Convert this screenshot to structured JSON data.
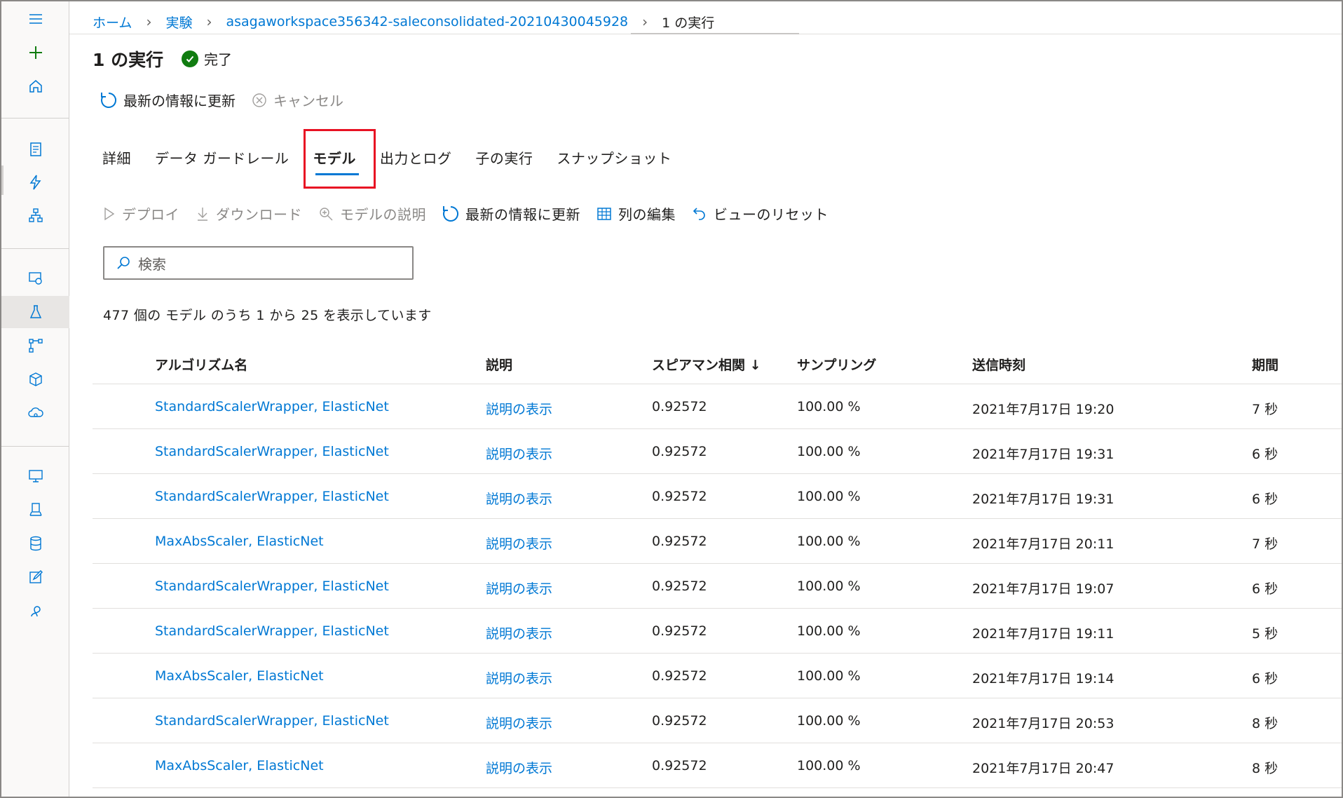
{
  "breadcrumb": {
    "home": "ホーム",
    "experiments": "実験",
    "experiment_name": "asagaworkspace356342-saleconsolidated-20210430045928",
    "current": "1 の実行"
  },
  "page": {
    "title": "1 の実行",
    "status": "完了"
  },
  "commands": {
    "refresh": "最新の情報に更新",
    "cancel": "キャンセル"
  },
  "tabs": [
    "詳細",
    "データ ガードレール",
    "モデル",
    "出力とログ",
    "子の実行",
    "スナップショット"
  ],
  "selected_tab": "モデル",
  "toolbar": {
    "deploy": "デプロイ",
    "download": "ダウンロード",
    "explain": "モデルの説明",
    "refresh": "最新の情報に更新",
    "edit_columns": "列の編集",
    "reset_view": "ビューのリセット"
  },
  "search": {
    "placeholder": "検索"
  },
  "summary": "477 個の モデル のうち 1 から 25 を表示しています",
  "table": {
    "columns": {
      "algorithm": "アルゴリズム名",
      "explanation": "説明",
      "spearman": "スピアマン相関 ↓",
      "sampling": "サンプリング",
      "submitted": "送信時刻",
      "duration": "期間"
    },
    "rows": [
      {
        "algorithm": "StandardScalerWrapper, ElasticNet",
        "explanation": "説明の表示",
        "spearman": "0.92572",
        "sampling": "100.00 %",
        "submitted": "2021年7月17日 19:20",
        "duration": "7 秒"
      },
      {
        "algorithm": "StandardScalerWrapper, ElasticNet",
        "explanation": "説明の表示",
        "spearman": "0.92572",
        "sampling": "100.00 %",
        "submitted": "2021年7月17日 19:31",
        "duration": "6 秒"
      },
      {
        "algorithm": "StandardScalerWrapper, ElasticNet",
        "explanation": "説明の表示",
        "spearman": "0.92572",
        "sampling": "100.00 %",
        "submitted": "2021年7月17日 19:31",
        "duration": "6 秒"
      },
      {
        "algorithm": "MaxAbsScaler, ElasticNet",
        "explanation": "説明の表示",
        "spearman": "0.92572",
        "sampling": "100.00 %",
        "submitted": "2021年7月17日 20:11",
        "duration": "7 秒"
      },
      {
        "algorithm": "StandardScalerWrapper, ElasticNet",
        "explanation": "説明の表示",
        "spearman": "0.92572",
        "sampling": "100.00 %",
        "submitted": "2021年7月17日 19:07",
        "duration": "6 秒"
      },
      {
        "algorithm": "StandardScalerWrapper, ElasticNet",
        "explanation": "説明の表示",
        "spearman": "0.92572",
        "sampling": "100.00 %",
        "submitted": "2021年7月17日 19:11",
        "duration": "5 秒"
      },
      {
        "algorithm": "MaxAbsScaler, ElasticNet",
        "explanation": "説明の表示",
        "spearman": "0.92572",
        "sampling": "100.00 %",
        "submitted": "2021年7月17日 19:14",
        "duration": "6 秒"
      },
      {
        "algorithm": "StandardScalerWrapper, ElasticNet",
        "explanation": "説明の表示",
        "spearman": "0.92572",
        "sampling": "100.00 %",
        "submitted": "2021年7月17日 20:53",
        "duration": "8 秒"
      },
      {
        "algorithm": "MaxAbsScaler, ElasticNet",
        "explanation": "説明の表示",
        "spearman": "0.92572",
        "sampling": "100.00 %",
        "submitted": "2021年7月17日 20:47",
        "duration": "8 秒"
      }
    ]
  },
  "colors": {
    "accent": "#0078d4",
    "success": "#107c10",
    "highlight": "#e81123"
  },
  "rail_icons": [
    "menu-icon",
    "add-icon",
    "home-icon",
    "notebook-icon",
    "automl-icon",
    "designer-icon",
    "datasets-icon",
    "experiments-icon",
    "pipelines-icon",
    "models-icon",
    "endpoints-icon",
    "compute-icon",
    "environments-icon",
    "datastores-icon",
    "labeling-icon",
    "linked-services-icon"
  ]
}
